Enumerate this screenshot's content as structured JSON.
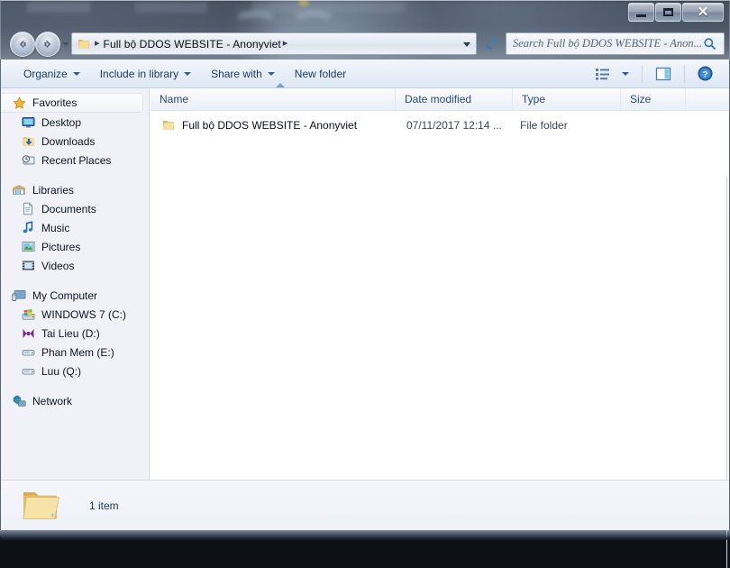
{
  "window": {
    "controls": {
      "minimize_label": "Minimize",
      "maximize_label": "Maximize",
      "close_label": "Close"
    }
  },
  "navigation": {
    "back_label": "Back",
    "forward_label": "Forward",
    "history_label": "Recent pages",
    "refresh_label": "Refresh"
  },
  "address": {
    "breadcrumb": "Full bộ DDOS WEBSITE - Anonyviet",
    "separator": "▸",
    "trailing_separator": "▸"
  },
  "search": {
    "placeholder": "Search Full bộ DDOS WEBSITE - Anon..."
  },
  "toolbar": {
    "organize": "Organize",
    "include_in_library": "Include in library",
    "share_with": "Share with",
    "new_folder": "New folder",
    "view_label": "Change your view",
    "preview_label": "Show the preview pane",
    "help_label": "Get help"
  },
  "navpane": {
    "groups": [
      {
        "root": "Favorites",
        "root_icon": "star-icon",
        "items": [
          {
            "label": "Desktop",
            "icon": "desktop-icon"
          },
          {
            "label": "Downloads",
            "icon": "downloads-icon"
          },
          {
            "label": "Recent Places",
            "icon": "recent-places-icon"
          }
        ]
      },
      {
        "root": "Libraries",
        "root_icon": "libraries-icon",
        "items": [
          {
            "label": "Documents",
            "icon": "documents-icon"
          },
          {
            "label": "Music",
            "icon": "music-icon"
          },
          {
            "label": "Pictures",
            "icon": "pictures-icon"
          },
          {
            "label": "Videos",
            "icon": "videos-icon"
          }
        ]
      },
      {
        "root": "My Computer",
        "root_icon": "computer-icon",
        "items": [
          {
            "label": "WINDOWS 7 (C:)",
            "icon": "windows-drive-icon"
          },
          {
            "label": "Tai Lieu  (D:)",
            "icon": "data-drive-icon"
          },
          {
            "label": "Phan Mem (E:)",
            "icon": "drive-icon"
          },
          {
            "label": "Luu (Q:)",
            "icon": "drive-icon"
          }
        ]
      },
      {
        "root": "Network",
        "root_icon": "network-icon",
        "items": []
      }
    ]
  },
  "filelist": {
    "columns": {
      "name": "Name",
      "date_modified": "Date modified",
      "type": "Type",
      "size": "Size"
    },
    "sort": {
      "column": "Name",
      "direction": "ascending"
    },
    "rows": [
      {
        "name": "Full bộ DDOS WEBSITE - Anonyviet",
        "date_modified": "07/11/2017 12:14 ...",
        "type": "File folder",
        "size": "",
        "icon": "folder-icon"
      }
    ]
  },
  "statusbar": {
    "item_count": "1 item",
    "icon": "folder-large-icon"
  },
  "colors": {
    "folder_yellow": "#f3d07a",
    "accent_blue": "#2a4a7a",
    "close_red": "#c63b23",
    "window_bg": "#ffffff",
    "navpane_bg": "#f0f2f7"
  }
}
